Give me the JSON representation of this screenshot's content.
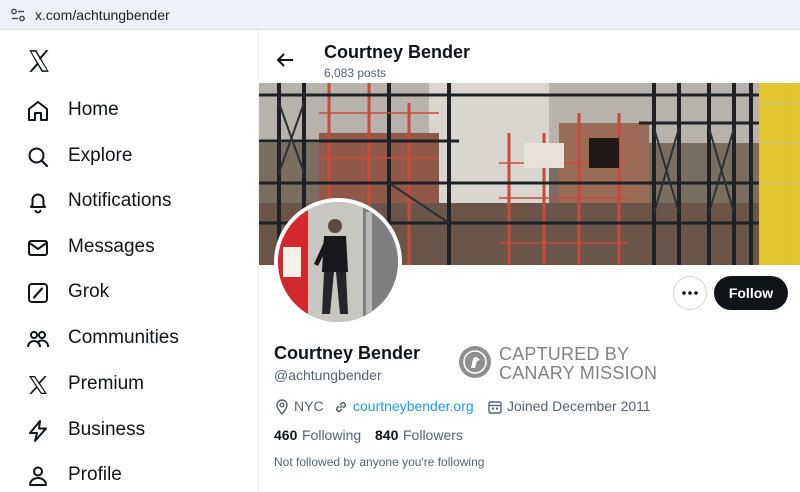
{
  "browser": {
    "url": "x.com/achtungbender"
  },
  "sidebar": {
    "items": [
      {
        "label": "Home",
        "icon": "home-icon"
      },
      {
        "label": "Explore",
        "icon": "search-icon"
      },
      {
        "label": "Notifications",
        "icon": "bell-icon"
      },
      {
        "label": "Messages",
        "icon": "envelope-icon"
      },
      {
        "label": "Grok",
        "icon": "grok-icon"
      },
      {
        "label": "Communities",
        "icon": "people-icon"
      },
      {
        "label": "Premium",
        "icon": "x-logo-icon"
      },
      {
        "label": "Business",
        "icon": "lightning-icon"
      },
      {
        "label": "Profile",
        "icon": "person-icon"
      }
    ]
  },
  "header": {
    "name": "Courtney Bender",
    "posts": "6,083 posts"
  },
  "profile": {
    "name": "Courtney Bender",
    "handle": "@achtungbender",
    "location": "NYC",
    "website": "courtneybender.org",
    "joined": "Joined December 2011",
    "following_count": "460",
    "following_label": "Following",
    "followers_count": "840",
    "followers_label": "Followers",
    "followed_note": "Not followed by anyone you're following"
  },
  "actions": {
    "follow_label": "Follow"
  },
  "watermark": {
    "line1": "CAPTURED BY",
    "line2": "CANARY MISSION"
  },
  "colors": {
    "accent": "#1d9bf0",
    "text": "#0f1419",
    "muted": "#536471",
    "button": "#0f1419"
  }
}
